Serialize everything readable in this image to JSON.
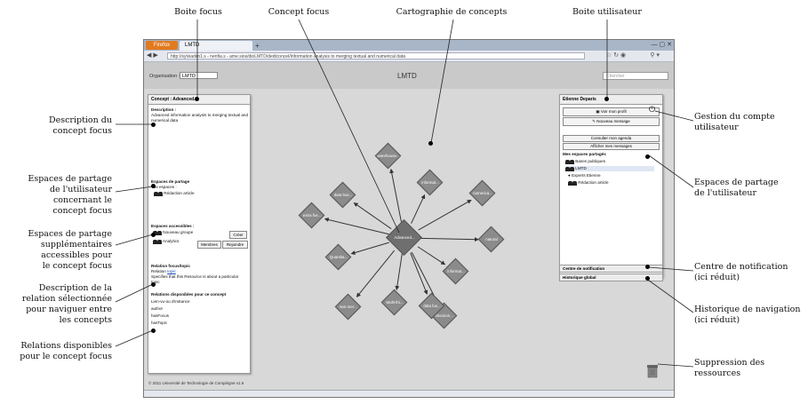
{
  "labels": {
    "boite_focus": "Boite focus",
    "concept_focus": "Concept focus",
    "cartographie": "Cartographie de concepts",
    "boite_utilisateur": "Boite utilisateur",
    "description_focus": [
      "Description du",
      "concept focus"
    ],
    "espaces_partage_user_focus": [
      "Espaces de partage",
      "de l'utilisateur",
      "concernant le",
      "concept focus"
    ],
    "espaces_supplementaires": [
      "Espaces de partage",
      "supplémentaires",
      "accessibles pour",
      "le concept focus"
    ],
    "description_relation": [
      "Description de la",
      "relation sélectionnée",
      "pour naviguer entre",
      "les concepts"
    ],
    "relations_disponibles": [
      "Relations disponibles",
      "pour le concept focus"
    ],
    "gestion_compte": [
      "Gestion du compte",
      "utilisateur"
    ],
    "espaces_partage_user": [
      "Espaces de partage",
      "de l'utilisateur"
    ],
    "centre_notification": [
      "Centre de notification",
      "(ici réduit)"
    ],
    "historique": [
      "Historique de navigation",
      "(ici réduit)"
    ],
    "suppression": [
      "Suppression des",
      "ressources"
    ]
  },
  "browser": {
    "ff_button": "Firefox",
    "tab_title": "LMTD",
    "url": "http://sylviadim1.s - nenfia.s - ame.sios/dioLMTD/dedlconcel/Information analysis to merging textual and numerical data",
    "new_tab": "+",
    "window_buttons": "— ▢ ✕"
  },
  "app": {
    "org_label": "Organisation :",
    "org_value": "LMTD",
    "title": "LMTD",
    "search_placeholder": "Chercher",
    "footer": "© 2011 Université de Technologie de Compiègne v1.6"
  },
  "focus_box": {
    "header": "Concept : Advanced...",
    "description_title": "Description :",
    "description_text": [
      "Advanced information analysis to merging textual and",
      "numerical data"
    ],
    "shared_title": "Espaces de partage",
    "shared_sub": "Vos espaces :",
    "shared_items": [
      "Rédaction article"
    ],
    "accessible_title": "Espaces accessibles :",
    "accessible_items": [
      "Nouveau groupe",
      "Analytics"
    ],
    "btn_creer": "Créer",
    "btn_membres": "Membres",
    "btn_rejoindre": "Rejoindre",
    "relation_title": "Relation focus/topic",
    "relation_label": "Relation",
    "relation_link": "topic",
    "relation_text": [
      "Specifies that this Resource is about a particular",
      "topic"
    ],
    "relations_title": "Relations disponibles pour ce concept",
    "relations": [
      "Lien-vu-ou d'instance",
      "author",
      "hasFocus",
      "hasTopic"
    ]
  },
  "user_box": {
    "header": "Etienne Deparis",
    "btn_profil": "Voir mon profil",
    "btn_message": "Nouveau message",
    "btn_agenda": "Consulter mon agenda",
    "btn_messages": "Afficher mes messages",
    "shared_title": "Mes espaces partagés",
    "shared_items": [
      "Bases publiques",
      "LMTD",
      "Experts Etienne",
      "Rédaction article"
    ],
    "notification": "Centre de notification",
    "history": "Historique global"
  },
  "graph": {
    "center": "Advanced...",
    "nodes": [
      "warehouse...",
      "data bus...",
      "informat...",
      "numerica...",
      "natural",
      "informat...",
      "decision...",
      "Multi-thi...",
      "text mer...",
      "Quantita...",
      "data fus...",
      "extra fus..."
    ]
  }
}
